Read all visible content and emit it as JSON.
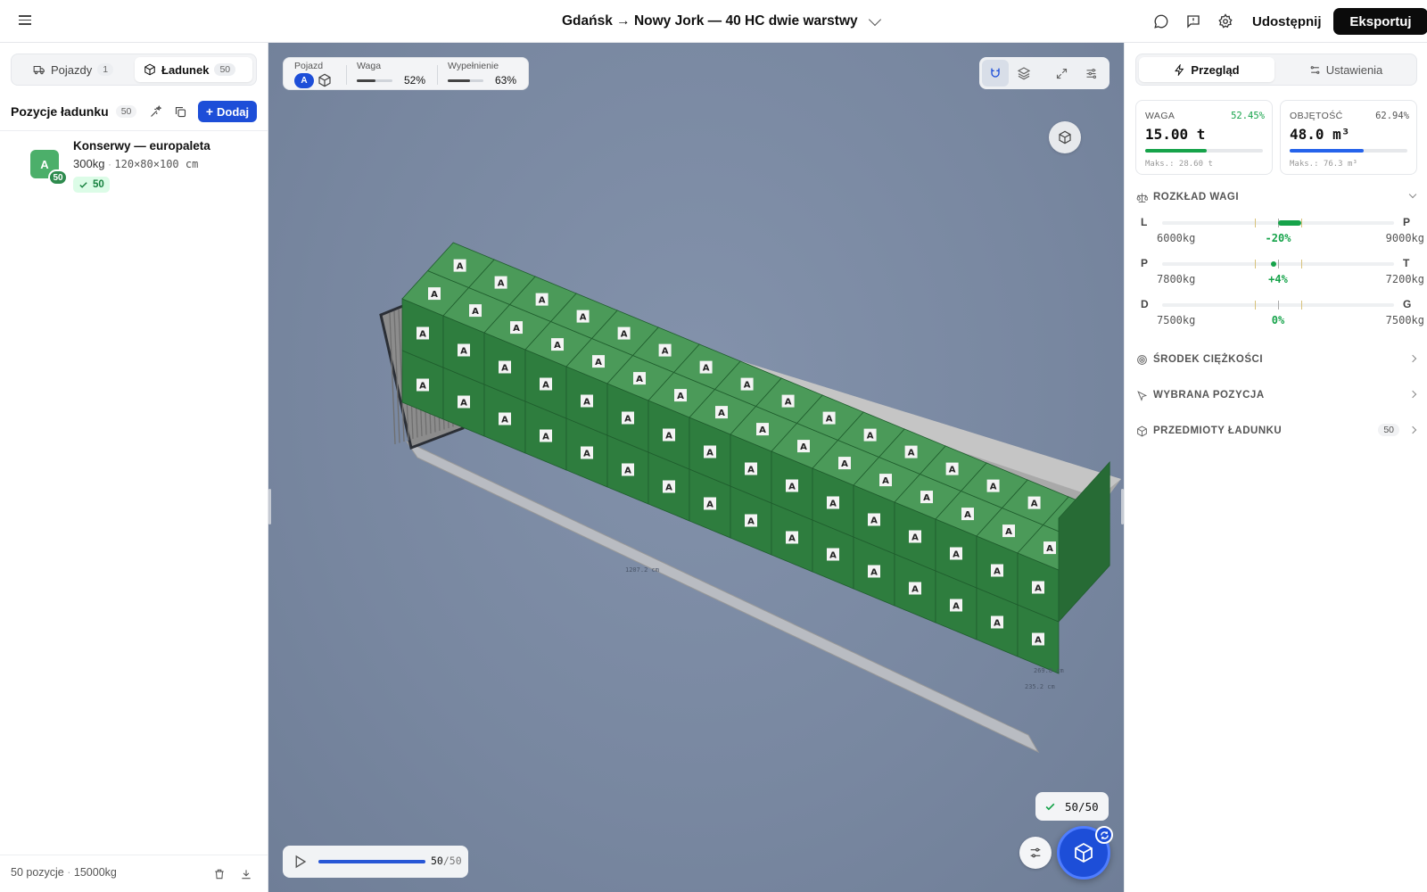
{
  "header": {
    "title": "Gdańsk → Nowy Jork — 40 HC dwie warstwy",
    "share_label": "Udostępnij",
    "export_label": "Eksportuj"
  },
  "left": {
    "tabs": [
      {
        "label": "Pojazdy",
        "count": "1"
      },
      {
        "label": "Ładunek",
        "count": "50"
      }
    ],
    "list_title": "Pozycje ładunku",
    "list_count": "50",
    "add_label": "Dodaj",
    "items": [
      {
        "avatar": "A",
        "badge": "50",
        "name": "Konserwy — europaleta",
        "weight": "300kg",
        "dims": "120×80×100 cm",
        "status": "50"
      }
    ],
    "footer": {
      "count": "50 pozycje",
      "weight": "15000kg"
    }
  },
  "viewport": {
    "vehicle_label": "Pojazd",
    "vehicle_letter": "A",
    "weight_label": "Waga",
    "weight_pct": "52%",
    "weight_fill": 0.52,
    "fill_label": "Wypełnienie",
    "fill_pct": "63%",
    "fill_fill": 0.63,
    "progress": "50/50",
    "play": {
      "current": "50",
      "total": "/50",
      "fraction": 1.0
    },
    "box_label": "A",
    "dimension_labels": [
      "1207.2 cm",
      "269.8 cm",
      "235.2 cm"
    ]
  },
  "right": {
    "tabs": [
      "Przegląd",
      "Ustawienia"
    ],
    "weight": {
      "label": "WAGA",
      "pct": "52.45%",
      "value": "15.00 t",
      "max": "Maks.: 28.60 t",
      "fraction": 0.5245,
      "color": "#16a34a"
    },
    "volume": {
      "label": "OBJĘTOŚĆ",
      "pct": "62.94%",
      "value": "48.0 m³",
      "max": "Maks.: 76.3 m³",
      "fraction": 0.6294,
      "color": "#2563eb"
    },
    "distribution": {
      "title": "ROZKŁAD WAGI",
      "rows": [
        {
          "left": "L",
          "right": "P",
          "v1": "6000kg",
          "mid": "-20%",
          "v2": "9000kg",
          "offset": -0.2
        },
        {
          "left": "P",
          "right": "T",
          "v1": "7800kg",
          "mid": "+4%",
          "v2": "7200kg",
          "offset": 0.04
        },
        {
          "left": "D",
          "right": "G",
          "v1": "7500kg",
          "mid": "0%",
          "v2": "7500kg",
          "offset": 0
        }
      ]
    },
    "sections": [
      {
        "label": "ŚRODEK CIĘŻKOŚCI"
      },
      {
        "label": "WYBRANA POZYCJA"
      },
      {
        "label": "PRZEDMIOTY ŁADUNKU",
        "count": "50"
      }
    ]
  },
  "colors": {
    "accent": "#1d4ed8",
    "cargo_top": "#4b9a59",
    "cargo_side": "#2e7d3e",
    "success": "#16a34a"
  }
}
